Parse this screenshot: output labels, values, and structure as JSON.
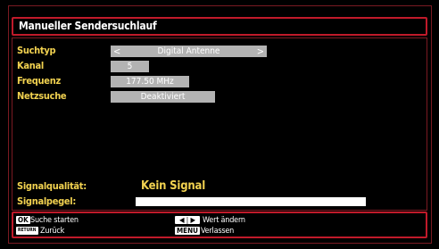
{
  "title": "Manueller Sendersuchlauf",
  "fields": {
    "suchtyp": {
      "label": "Suchtyp",
      "value": "Digital Antenne",
      "left_arrow": "<",
      "right_arrow": ">"
    },
    "kanal": {
      "label": "Kanal",
      "value": "5"
    },
    "frequenz": {
      "label": "Frequenz",
      "value": "177.50 MHz"
    },
    "netzsuche": {
      "label": "Netzsuche",
      "value": "Deaktiviert"
    }
  },
  "signal": {
    "quality_label": "Signalqualität:",
    "quality_value": "Kein Signal",
    "level_label": "Signalpegel:"
  },
  "footer": {
    "ok_key": "OK",
    "ok_text": "Suche starten",
    "return_key": "RETURN",
    "return_text": "Zurück",
    "lr_key": "◀ | ▶",
    "lr_text": "Wert ändern",
    "menu_key": "MENU",
    "menu_text": "Verlassen"
  },
  "colors": {
    "accent": "#c01a2a",
    "label": "#f2d250",
    "field": "#b3b3b3",
    "background": "#000000"
  }
}
